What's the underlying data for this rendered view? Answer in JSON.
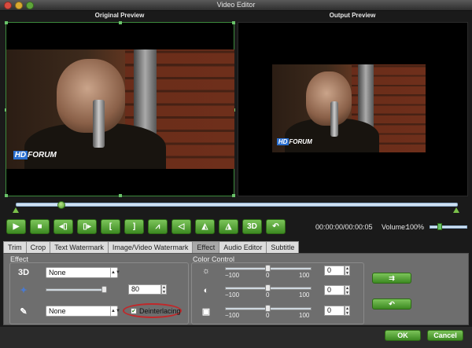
{
  "window": {
    "title": "Video Editor"
  },
  "previews": {
    "original_label": "Original Preview",
    "output_label": "Output Preview"
  },
  "video": {
    "logo_hd": "HD",
    "logo_text": "FORUM"
  },
  "playback": {
    "timecode": "00:00:00/00:00:05",
    "volume_label": "Volume:",
    "volume_value": "100%",
    "buttons": [
      "play",
      "stop",
      "prev-frame",
      "next-frame",
      "mark-in",
      "mark-out",
      "flip-vertical",
      "rotate-left",
      "flip-horizontal",
      "rotate-right",
      "3d",
      "undo"
    ],
    "btn_3d_label": "3D"
  },
  "tabs": [
    "Trim",
    "Crop",
    "Text Watermark",
    "Image/Video Watermark",
    "Effect",
    "Audio Editor",
    "Subtitle"
  ],
  "active_tab": "Effect",
  "effect": {
    "group_label": "Effect",
    "three_d_select": "None",
    "three_d_icon_text": "3D",
    "strength_value": "80",
    "filter_select": "None",
    "deinterlacing_label": "Deinterlacing",
    "deinterlacing_checked": true
  },
  "color_control": {
    "group_label": "Color Control",
    "rows": [
      {
        "name": "brightness",
        "min": "−100",
        "mid": "0",
        "max": "100",
        "value": "0"
      },
      {
        "name": "contrast",
        "min": "−100",
        "mid": "0",
        "max": "100",
        "value": "0"
      },
      {
        "name": "saturation",
        "min": "−100",
        "mid": "0",
        "max": "100",
        "value": "0"
      }
    ]
  },
  "side_buttons": {
    "apply_icon": "apply-icon",
    "reset_icon": "reset-icon"
  },
  "footer": {
    "ok_label": "OK",
    "cancel_label": "Cancel"
  },
  "colors": {
    "accent": "#4e9a2a",
    "highlight": "#c0282a"
  }
}
